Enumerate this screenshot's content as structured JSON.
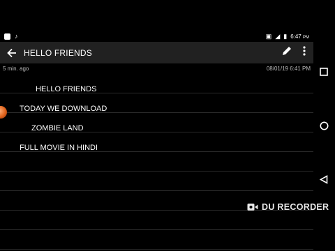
{
  "statusbar": {
    "time": "6:47",
    "ampm": "PM"
  },
  "toolbar": {
    "title": "HELLO  FRIENDS"
  },
  "meta": {
    "ago": "5 min. ago",
    "date": "08/01/19 6:41 PM"
  },
  "note": {
    "lines": [
      "HELLO  FRIENDS",
      "TODAY WE DOWNLOAD",
      "ZOMBIE LAND",
      "FULL MOVIE IN HINDI"
    ]
  },
  "overlay": {
    "recorder_label": "DU RECORDER"
  }
}
